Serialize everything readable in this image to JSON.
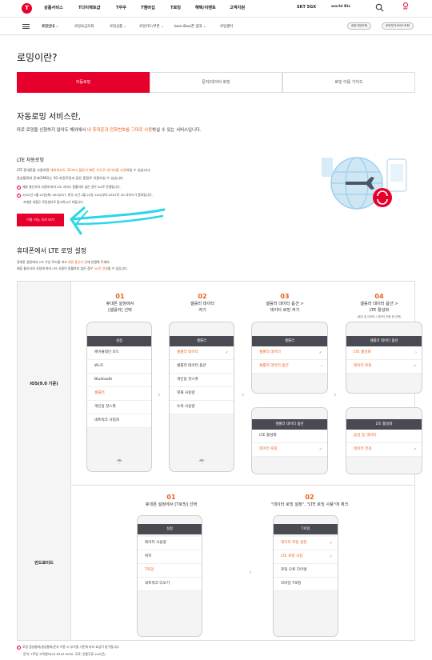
{
  "header": {
    "logo": "T",
    "menu": [
      "상품서비스",
      "T다이렉트샵",
      "T우주",
      "T멤버십",
      "T로밍",
      "혜택/이벤트",
      "고객지원"
    ],
    "brand1": "SKT 5GX",
    "brand2": "world Biz",
    "my_label": "MY"
  },
  "subnav": {
    "items": [
      "로밍안내",
      "로밍요금조회",
      "로밍상품",
      "로밍카드/쿠폰",
      "baro Box/폰 임대",
      "로밍센터"
    ],
    "pills": [
      "로밍가입조회",
      "로밍부가서비스조회"
    ]
  },
  "page_title": "로밍이란?",
  "tabs": [
    "자동로밍",
    "문자/데이터 로밍",
    "로밍 이용 가이드"
  ],
  "intro": {
    "title": "자동로밍 서비스란,",
    "desc_pre": "따로 로밍을 신청하지 않아도 해외에서 ",
    "desc_hl": "내 휴대폰과 전화번호를 그대로 사용",
    "desc_post": "하실 수 있는 서비스입니다."
  },
  "lte": {
    "title": "LTE 자동로밍",
    "line1_pre": "LTE 휴대폰을 사용하면 ",
    "line1_hl": "해외에서도 3G보다 월등히 빠른 속도로 데이터를 사용",
    "line1_post": "하실 수 있습니다.",
    "line2": "음성통화와 문자(SMS)는 3G 자동로밍과 같은 품질로 이용하실 수 있습니다.",
    "note1": "제휴 통신사의 사정에 따라 LTE 서비스 원활하지 않은 경우 3G로 연결됩니다.",
    "note2": "2022년 2월 22일(화) 00시(EST, 한국 시간 2월 22일 14시)부터 AT&T의 3G 서비스가 종료됩니다.",
    "note3": "자세한 내용은 로밍센터로 참고하시기 바랍니다.",
    "button": "이용 가능 국가 보기"
  },
  "setting": {
    "title": "휴대폰에서 LTE 로밍 설정",
    "desc1_pre": "휴대폰 설정에서 LTE 우선 모드를 켜고 ",
    "desc1_hl": "제휴 통신사 망",
    "desc1_post": "에 연결해 주세요.",
    "desc2_pre": "제휴 통신사의 사정에 따라 LTE 사용이 원활하지 않은 경우 ",
    "desc2_hl": "3G로 연결",
    "desc2_post": "될 수 있습니다."
  },
  "ios": {
    "label": "iOS(9.0 기준)",
    "steps": [
      {
        "num": "01",
        "text": "휴대폰 설정에서\n[셀룰러] 선택",
        "sub": ""
      },
      {
        "num": "02",
        "text": "셀룰러 데이터\n켜기",
        "sub": ""
      },
      {
        "num": "03",
        "text": "셀룰러 데이터 옵션 >\n데이터 로밍 켜기",
        "sub": ""
      },
      {
        "num": "04",
        "text": "셀룰러 데이터 옵션 >\nLTE 활성화",
        "sub": "(음성 및 데이터 / 데이터 전용 중 선택)"
      }
    ],
    "phone1": {
      "bar": "설정",
      "items": [
        "에어플레인 모드",
        "Wi-Fi",
        "Bluetooth",
        "셀룰러",
        "개인용 핫스팟",
        "네트워크 사업자"
      ],
      "hl": 3
    },
    "phone2": {
      "bar": "셀룰러",
      "items": [
        "셀룰러 데이터",
        "셀룰러 데이터 옵션",
        "개인용 핫스팟",
        "현재 사용량",
        "누적 사용량"
      ],
      "hl": 0
    },
    "phone3a": {
      "bar": "셀룰러",
      "items": [
        "셀룰러 데이터",
        "셀룰러 데이터 옵션"
      ]
    },
    "phone3b": {
      "bar": "셀룰러 데이터 옵션",
      "items": [
        "LTE 활성화",
        "데이터 로밍"
      ]
    },
    "phone4a": {
      "bar": "셀룰러 데이터 옵션",
      "items": [
        "LTE 활성화",
        "데이터 로밍"
      ]
    },
    "phone4b": {
      "bar": "LTE 활성화",
      "items": [
        "음성 및 데이터",
        "데이터 전용"
      ]
    }
  },
  "android": {
    "label": "안드로이드",
    "steps": [
      {
        "num": "01",
        "text": "휴대폰 설정에서 [T로밍] 선택"
      },
      {
        "num": "02",
        "text": "\"데이터 로밍 설정\", \"LTE 로밍 사용\"에 체크"
      }
    ],
    "phone1": {
      "bar": "설정",
      "items": [
        "데이터 사용량",
        "위치",
        "T로밍",
        "네트워크 더보기"
      ],
      "hl": 2
    },
    "phone2": {
      "bar": "T로밍",
      "items": [
        "데이터 로밍 설정",
        "LTE 로밍 사용",
        "로밍 오토 다이얼",
        "모바일 T로밍"
      ]
    }
  },
  "footer": {
    "note1": "로밍 음성통화/영상통화/문자 이용 시 부가될 기준에 따라 요금이 청구됩니다.",
    "note2": "문의: T로밍 고객센터(02-6343-9000, 무료, 연중무휴 24시간)"
  },
  "colors": {
    "accent": "#e8002d",
    "highlight": "#e8601c",
    "dark_bar": "#4a4a52"
  }
}
